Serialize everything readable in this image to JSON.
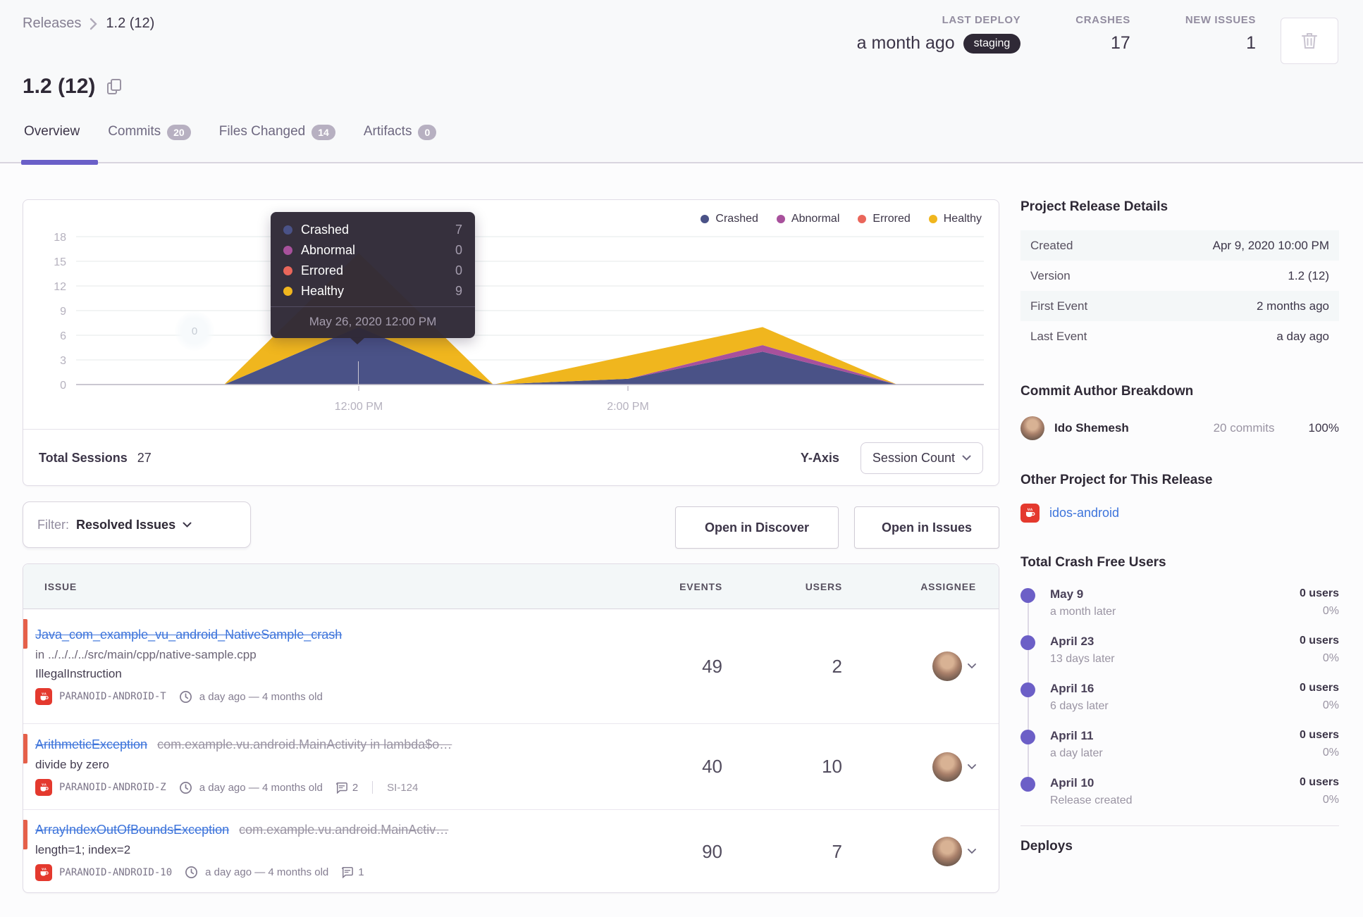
{
  "breadcrumb": {
    "parent": "Releases",
    "current": "1.2 (12)"
  },
  "header": {
    "stats": [
      {
        "label": "LAST DEPLOY",
        "value": "a month ago",
        "badge": "staging"
      },
      {
        "label": "CRASHES",
        "value": "17"
      },
      {
        "label": "NEW ISSUES",
        "value": "1"
      }
    ]
  },
  "page": {
    "title": "1.2 (12)"
  },
  "tabs": [
    {
      "label": "Overview"
    },
    {
      "label": "Commits",
      "badge": "20"
    },
    {
      "label": "Files Changed",
      "badge": "14"
    },
    {
      "label": "Artifacts",
      "badge": "0"
    }
  ],
  "chart_data": {
    "type": "area",
    "stacked": true,
    "title": "Release sessions over time",
    "x_hours": [
      10,
      11,
      12,
      13,
      14,
      15,
      16
    ],
    "series": [
      {
        "name": "Crashed",
        "color": "#4a5287",
        "values": [
          0,
          0,
          7,
          0,
          0.7,
          4,
          0
        ]
      },
      {
        "name": "Abnormal",
        "color": "#a8519c",
        "values": [
          0,
          0,
          0,
          0,
          0,
          0.8,
          0
        ]
      },
      {
        "name": "Errored",
        "color": "#ea665b",
        "values": [
          0,
          0,
          0,
          0,
          0,
          0,
          0
        ]
      },
      {
        "name": "Healthy",
        "color": "#f0b61e",
        "values": [
          0,
          0,
          9,
          0,
          2.8,
          2.2,
          0
        ]
      }
    ],
    "y_ticks": [
      0,
      3,
      6,
      9,
      12,
      15,
      18
    ],
    "ylim": [
      0,
      18
    ],
    "x_ticks": [
      {
        "label": "12:00 PM",
        "hour": 12
      },
      {
        "label": "2:00 PM",
        "hour": 14
      }
    ],
    "point_label": "0",
    "legend_position": "top-right"
  },
  "tooltip": {
    "rows": [
      {
        "name": "Crashed",
        "value": "7"
      },
      {
        "name": "Abnormal",
        "value": "0"
      },
      {
        "name": "Errored",
        "value": "0"
      },
      {
        "name": "Healthy",
        "value": "9"
      }
    ],
    "footer": "May 26, 2020 12:00 PM"
  },
  "sessions_footer": {
    "label": "Total Sessions",
    "value": "27",
    "yaxis_label": "Y-Axis",
    "yaxis_value": "Session Count"
  },
  "filter": {
    "label": "Filter:",
    "value": "Resolved Issues"
  },
  "actions": {
    "discover": "Open in Discover",
    "issues": "Open in Issues"
  },
  "issues": {
    "columns": [
      "ISSUE",
      "EVENTS",
      "USERS",
      "ASSIGNEE"
    ],
    "rows": [
      {
        "title": "Java_com_example_vu_android_NativeSample_crash",
        "location": "in ../../../../src/main/cpp/native-sample.cpp",
        "message": "IllegalInstruction",
        "project": "PARANOID-ANDROID-T",
        "age": "a day ago — 4 months old",
        "events": "49",
        "users": "2"
      },
      {
        "title": "ArithmeticException",
        "culprit": "com.example.vu.android.MainActivity in lambda$o…",
        "message": "divide by zero",
        "project": "PARANOID-ANDROID-Z",
        "age": "a day ago — 4 months old",
        "comments": "2",
        "ref": "SI-124",
        "events": "40",
        "users": "10"
      },
      {
        "title": "ArrayIndexOutOfBoundsException",
        "culprit": "com.example.vu.android.MainActiv…",
        "message": "length=1; index=2",
        "project": "PARANOID-ANDROID-10",
        "age": "a day ago — 4 months old",
        "comments": "1",
        "events": "90",
        "users": "7"
      }
    ]
  },
  "sidebar": {
    "release_details": {
      "title": "Project Release Details",
      "rows": [
        {
          "label": "Created",
          "value": "Apr 9, 2020 10:00 PM"
        },
        {
          "label": "Version",
          "value": "1.2 (12)"
        },
        {
          "label": "First Event",
          "value": "2 months ago"
        },
        {
          "label": "Last Event",
          "value": "a day ago"
        }
      ]
    },
    "commit_authors": {
      "title": "Commit Author Breakdown",
      "author": {
        "name": "Ido Shemesh",
        "commits": "20 commits",
        "percent": "100%"
      }
    },
    "other_project": {
      "title": "Other Project for This Release",
      "link": "idos-android"
    },
    "crash_free": {
      "title": "Total Crash Free Users",
      "items": [
        {
          "date": "May 9",
          "sub": "a month later",
          "users": "0 users",
          "pct": "0%"
        },
        {
          "date": "April 23",
          "sub": "13 days later",
          "users": "0 users",
          "pct": "0%"
        },
        {
          "date": "April 16",
          "sub": "6 days later",
          "users": "0 users",
          "pct": "0%"
        },
        {
          "date": "April 11",
          "sub": "a day later",
          "users": "0 users",
          "pct": "0%"
        },
        {
          "date": "April 10",
          "sub": "Release created",
          "users": "0 users",
          "pct": "0%"
        }
      ]
    },
    "deploys": {
      "title": "Deploys"
    }
  },
  "colors": {
    "accent_purple": "#6C5FC7",
    "link_blue": "#3d74db",
    "badge_red": "#e4392e",
    "unhandled_red": "#e5604a",
    "dark_badge": "#2f2936"
  }
}
